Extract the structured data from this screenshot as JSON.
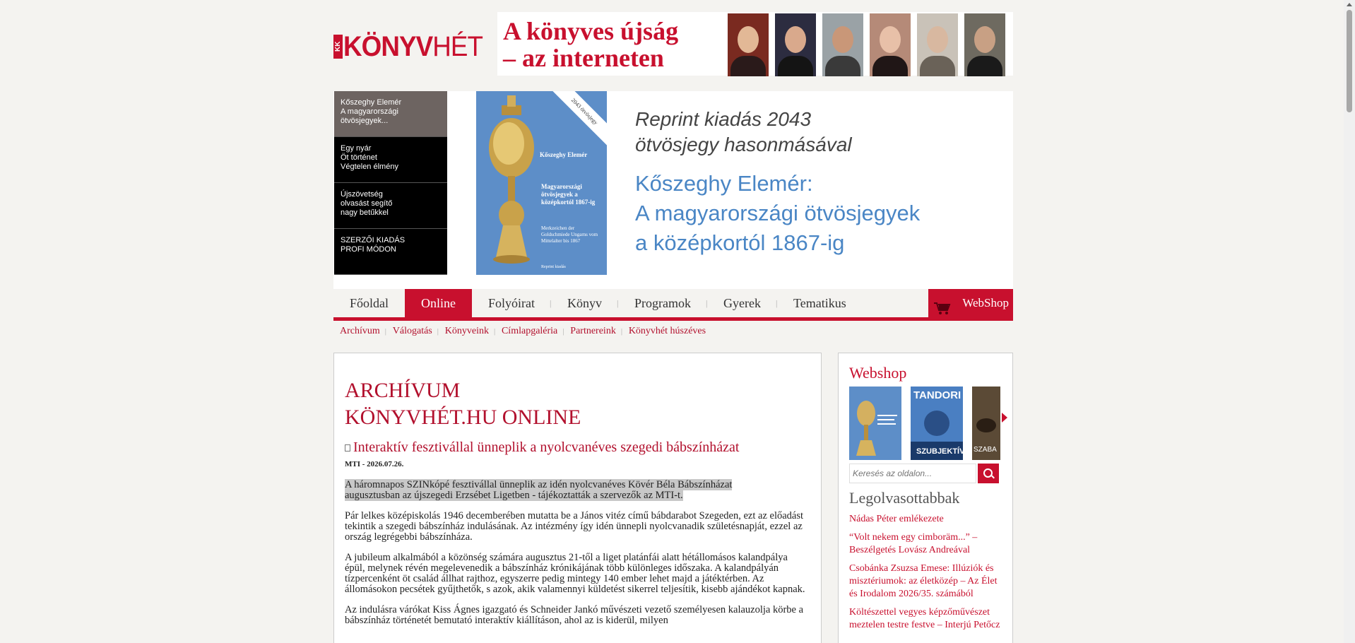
{
  "logo": {
    "kk": "KK",
    "bold": "KÖNYV",
    "thin": "HÉT"
  },
  "banner": {
    "slogan_line1": "A könyves újság",
    "slogan_line2": "– az interneten"
  },
  "feature": {
    "tabs": [
      {
        "label": "Kőszeghy Elemér\nA magyarországi\nötvösjegyek..."
      },
      {
        "label": "Egy nyár\nÖt történet\nVégtelen élmény"
      },
      {
        "label": "Újszövetség\nolvasást segítő\nnagy betűkkel"
      },
      {
        "label": "SZERZŐI KIADÁS\nPROFI MÓDON"
      }
    ],
    "cover": {
      "corner": "2043 ötvösjegy",
      "author": "Kőszeghy Elemér",
      "title": "Magyarországi ötvösjegyek a középkortól 1867-ig",
      "subtitle": "Merkzeichen der Goldschmiede Ungarns vom Mittelalter bis 1867",
      "publisher": "Reprint kiadás"
    },
    "text_line1": "Reprint kiadás 2043",
    "text_line2": "ötvösjegy hasonmásával",
    "text_line3": "Kőszeghy Elemér:",
    "text_line4": "A magyarországi ötvösjegyek",
    "text_line5": "a középkortól 1867-ig"
  },
  "nav": {
    "items": [
      "Főoldal",
      "Online",
      "Folyóirat",
      "Könyv",
      "Programok",
      "Gyerek",
      "Tematikus"
    ],
    "active": "Online",
    "webshop": "WebShop"
  },
  "subnav": [
    "Archívum",
    "Válogatás",
    "Könyveink",
    "Címlapgaléria",
    "Partnereink",
    "Könyvhét húszéves"
  ],
  "article": {
    "section_line1": "ARCHÍVUM",
    "section_line2": "KÖNYVHÉT.HU ONLINE",
    "title": "Interaktív fesztivállal ünneplik a nyolcvanéves szegedi bábszínházat",
    "meta": "MTI - 2026.07.26.",
    "lead_line1": "A háromnapos SZINkópé fesztivállal ünneplik az idén nyolcvanéves Kövér Béla Bábszínházat",
    "lead_line2": "augusztusban az újszegedi Erzsébet Ligetben - tájékoztatták a szervezők az MTI-t.",
    "p1": "Pár lelkes középiskolás 1946 decemberében mutatta be a János vitéz című bábdarabot Szegeden, ezt az előadást tekintik a szegedi bábszínház indulásának. Az intézmény így idén ünnepli nyolcvanadik születésnapját, ezzel az ország legrégebbi bábszínháza.",
    "p2": "A jubileum alkalmából a közönség számára augusztus 21-től a liget platánfái alatt hétállomásos kalandpálya épül, melynek révén megelevenedik a bábszínház krónikájának több különleges időszaka. A kalandpályán tízpercenként öt család állhat rajthoz, egyszerre pedig mintegy 140 ember lehet majd a játéktérben. Az állomásokon pecsétek gyűjthetők, s azok, akik valamennyi küldetést sikerrel teljesítik, kisebb ajándékot kapnak.",
    "p3": "Az indulásra várókat Kiss Ágnes igazgató és Schneider Jankó művészeti vezető személyesen kalauzolja körbe a bábszínház történetét bemutató interaktív kiállításon, ahol az is kiderül, milyen"
  },
  "sidebar": {
    "webshop_title": "Webshop",
    "carousel_books": [
      {
        "title": ""
      },
      {
        "title": "TANDORI",
        "subtitle": "SZUBJEKTÍV"
      },
      {
        "title": "SZABA"
      }
    ],
    "search_placeholder": "Keresés az oldalon...",
    "most_read_title": "Legolvasottabbak",
    "most_read": [
      "Nádas Péter emlékezete",
      "“Volt nekem egy cimboräm...” – Beszélgetés Lovász Andreával",
      "Csobánka Zsuzsa Emese: Illúziók és misztériumok: az életközép – Az Élet és Irodalom 2026/35. számából",
      "Költészettel vegyes képzőművészet meztelen testre festve – Interjú Petőcz"
    ]
  },
  "colors": {
    "accent": "#c8102e",
    "link": "#b2102d",
    "feature_blue": "#4a86c5"
  }
}
